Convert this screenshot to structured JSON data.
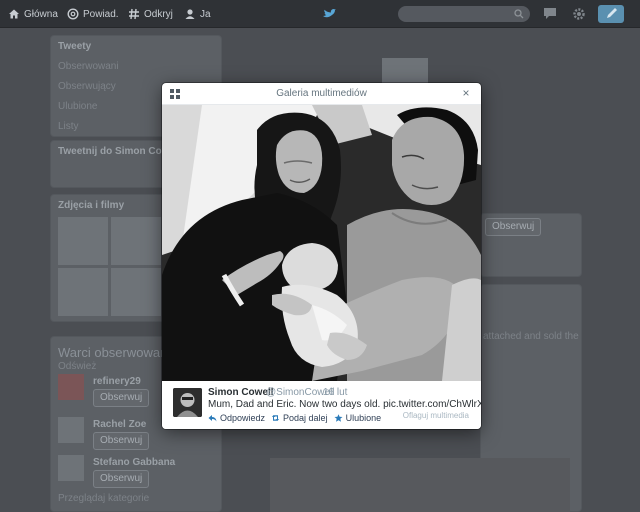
{
  "nav": {
    "home": "Główna",
    "notifications": "Powiad.",
    "discover": "Odkryj",
    "me": "Ja"
  },
  "background": {
    "menu": {
      "title": "Tweety",
      "items": [
        "Obserwowani",
        "Obserwujący",
        "Ulubione",
        "Listy"
      ]
    },
    "compose": {
      "title": "Tweetnij do Simon Cowell"
    },
    "media": {
      "title": "Zdjęcia i filmy"
    },
    "who_to_follow": {
      "title": "Warci obserwowania",
      "refresh": "Odśwież",
      "users": [
        {
          "name": "refinery29",
          "follow": "Obserwuj"
        },
        {
          "name": "Rachel Zoe",
          "follow": "Obserwuj"
        },
        {
          "name": "Stefano Gabbana",
          "follow": "Obserwuj"
        }
      ],
      "footer": "Przeglądaj kategorie"
    },
    "profile_follow": "Obserwuj",
    "right_text": "attached and sold the"
  },
  "modal": {
    "title": "Galeria multimediów",
    "close": "×"
  },
  "tweet": {
    "name": "Simon Cowell",
    "handle": "@SimonCowell",
    "time": "16 lut",
    "text": "Mum, Dad and Eric.  Now two days old.",
    "link": "pic.twitter.com/ChWlrXmtmO",
    "actions": {
      "reply": "Odpowiedz",
      "retweet": "Podaj dalej",
      "favorite": "Ulubione"
    },
    "flag": "Oflaguj multimedia"
  },
  "colors": {
    "accent": "#2b7bb9",
    "text": "#292f33",
    "muted": "#8899a6"
  }
}
